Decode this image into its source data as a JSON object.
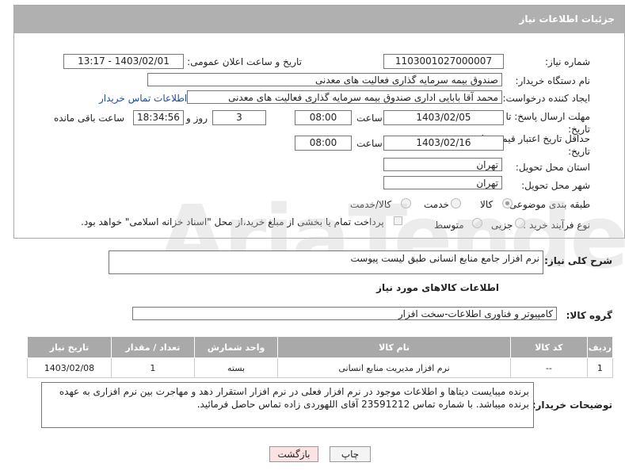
{
  "panel": {
    "title": "جزئیات اطلاعات نیاز"
  },
  "fields": {
    "need_number_label": "شماره نیاز:",
    "need_number": "1103001027000007",
    "announce_label": "تاریخ و ساعت اعلان عمومی:",
    "announce_value": "1403/02/01 - 13:17",
    "buyer_org_label": "نام دستگاه خریدار:",
    "buyer_org": "صندوق بیمه سرمایه گذاری فعالیت های معدنی",
    "requester_label": "ایجاد کننده درخواست:",
    "requester": "محمد آقا بابایی اداری صندوق بیمه سرمایه گذاری فعالیت های معدنی",
    "buyer_contact_link": "اطلاعات تماس خریدار",
    "deadline_label": "مهلت ارسال پاسخ: تا تاریخ:",
    "deadline_date": "1403/02/05",
    "time_word": "ساعت",
    "deadline_time": "08:00",
    "days_value": "3",
    "days_word": "روز و",
    "remaining_time": "18:34:56",
    "remaining_word": "ساعت باقی مانده",
    "validity_label": "حداقل تاریخ اعتبار قیمت: تا تاریخ:",
    "validity_date": "1403/02/16",
    "validity_time": "08:00",
    "province_label": "استان محل تحویل:",
    "province": "تهران",
    "city_label": "شهر محل تحویل:",
    "city": "تهران",
    "category_label": "طبقه بندی موضوعی:",
    "category_options": [
      "کالا",
      "خدمت",
      "کالا/خدمت"
    ],
    "process_label": "نوع فرآیند خرید :",
    "process_options": [
      "جزیی",
      "متوسط"
    ],
    "payment_note": "پرداخت تمام یا بخشی از مبلغ خرید،از محل \"اسناد خزانه اسلامی\" خواهد بود."
  },
  "description": {
    "label": "شرح کلی نیاز:",
    "value": "نرم افزار جامع منابع انسانی طبق لیست پیوست"
  },
  "goods_section": {
    "title": "اطلاعات کالاهای مورد نیاز",
    "group_label": "گروه کالا:",
    "group_value": "کامپیوتر و فناوری اطلاعات-سخت افزار"
  },
  "table": {
    "headers": [
      "ردیف",
      "کد کالا",
      "نام کالا",
      "واحد شمارش",
      "تعداد / مقدار",
      "تاریخ نیاز"
    ],
    "rows": [
      [
        "1",
        "--",
        "نرم افزار مدیریت منابع انسانی",
        "بسته",
        "1",
        "1403/02/08"
      ]
    ]
  },
  "buyer_notes": {
    "label": "توضیحات خریدار:",
    "value": "برنده میبایست دیتاها و اطلاعات موجود در نرم افزار فعلی در نرم افزار استقرار دهد و مهاجرت بین نرم افزاری به عهده برنده میباشد. با شماره تماس 23591212 آقای اللهوردی زاده تماس حاصل فرمائید."
  },
  "buttons": {
    "print": "چاپ",
    "back": "بازگشت"
  },
  "watermark_text": "AriaTender.net",
  "colors": {
    "header_bg": "#b0b0b0",
    "link": "#1a4fa0",
    "back_button_bg": "#fbe3e3"
  }
}
